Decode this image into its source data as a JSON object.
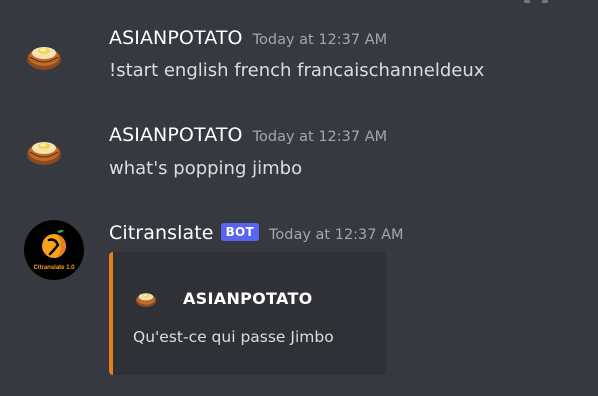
{
  "messages": [
    {
      "author": "ASIANPOTATO",
      "timestamp": "Today at 12:37 AM",
      "content": "!start english french francaischanneldeux",
      "avatar_icon": "baked-potato-icon"
    },
    {
      "author": "ASIANPOTATO",
      "timestamp": "Today at 12:37 AM",
      "content": "what's popping jimbo",
      "avatar_icon": "baked-potato-icon"
    },
    {
      "author": "Citranslate",
      "bot_tag": "BOT",
      "timestamp": "Today at 12:37 AM",
      "avatar_icon": "citranslate-logo-icon",
      "avatar_text": "Citranslate 1.0",
      "embed": {
        "accent_color": "#e67e22",
        "author_icon": "baked-potato-icon",
        "author_name": "ASIANPOTATO",
        "description": "Qu'est-ce qui passe Jimbo"
      }
    }
  ],
  "colors": {
    "background": "#36393f",
    "embed_background": "#2f3136",
    "bot_tag": "#5865f2",
    "timestamp": "#a3a6aa"
  }
}
